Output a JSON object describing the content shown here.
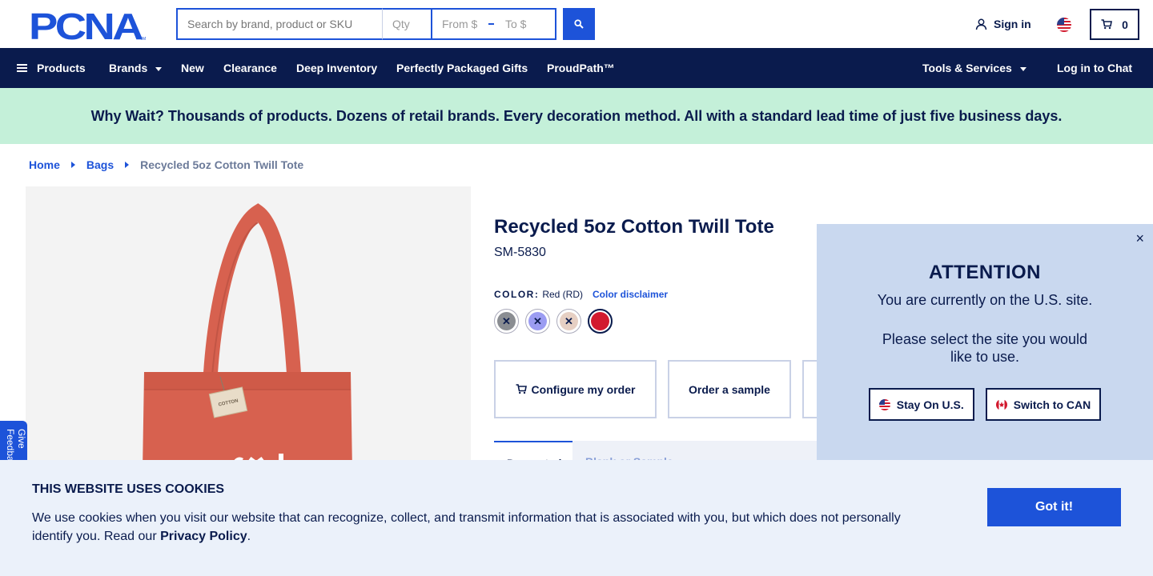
{
  "header": {
    "logo_text": "PCNA",
    "logo_mark": "TM",
    "search_placeholder": "Search by brand, product or SKU",
    "qty_placeholder": "Qty",
    "price_from_placeholder": "From $",
    "price_to_placeholder": "To $",
    "sign_in_label": "Sign in",
    "cart_count": "0",
    "search_icon": "magnifier-icon",
    "cart_icon": "cart-icon",
    "user_icon": "user-icon",
    "flag_icon": "us-flag-icon"
  },
  "nav": {
    "items": [
      {
        "label": "Products"
      },
      {
        "label": "Brands"
      },
      {
        "label": "New"
      },
      {
        "label": "Clearance"
      },
      {
        "label": "Deep Inventory"
      },
      {
        "label": "Perfectly Packaged Gifts"
      },
      {
        "label": "ProudPath™"
      },
      {
        "label": "Tools & Services"
      },
      {
        "label": "Log in to Chat"
      }
    ]
  },
  "promo": {
    "text": "Why Wait? Thousands of products. Dozens of retail brands. Every decoration method. All with a standard lead time of just five business days."
  },
  "breadcrumb": {
    "items": [
      "Home",
      "Bags"
    ],
    "current": "Recycled 5oz Cotton Twill Tote"
  },
  "product": {
    "title": "Recycled 5oz Cotton Twill Tote",
    "sku": "SM-5830",
    "color_label": "COLOR:",
    "color_value": "Red (RD)",
    "color_disclaimer": "Color disclaimer",
    "swatches": [
      {
        "color": "#8a8d92",
        "unavailable": true
      },
      {
        "color": "#9b9cf2",
        "unavailable": true
      },
      {
        "color": "#e6cfc3",
        "unavailable": true
      },
      {
        "color": "#d21a2e",
        "unavailable": false
      }
    ],
    "actions": {
      "configure": "Configure my order",
      "sample": "Order a sample"
    },
    "tabs": [
      "Decorated",
      "Blank or Sample"
    ],
    "tag_text": "COTTON",
    "colors": {
      "tote": "#d7614f",
      "accent": "#1d53d9",
      "navy": "#0a1b4d"
    }
  },
  "feedback": {
    "label": "Give Feedback"
  },
  "attention": {
    "title": "ATTENTION",
    "line1": "You are currently on the U.S. site.",
    "line2": "Please select the site you would like to use.",
    "stay_label": "Stay On U.S.",
    "switch_label": "Switch to CAN",
    "close_icon": "×"
  },
  "cookie": {
    "title": "THIS WEBSITE USES COOKIES",
    "text_before": "We use cookies when you visit our website that can recognize, collect, and transmit information that is associated with you, but which does not personally identify you. Read our ",
    "link": "Privacy Policy",
    "text_after": ".",
    "button": "Got it!"
  }
}
